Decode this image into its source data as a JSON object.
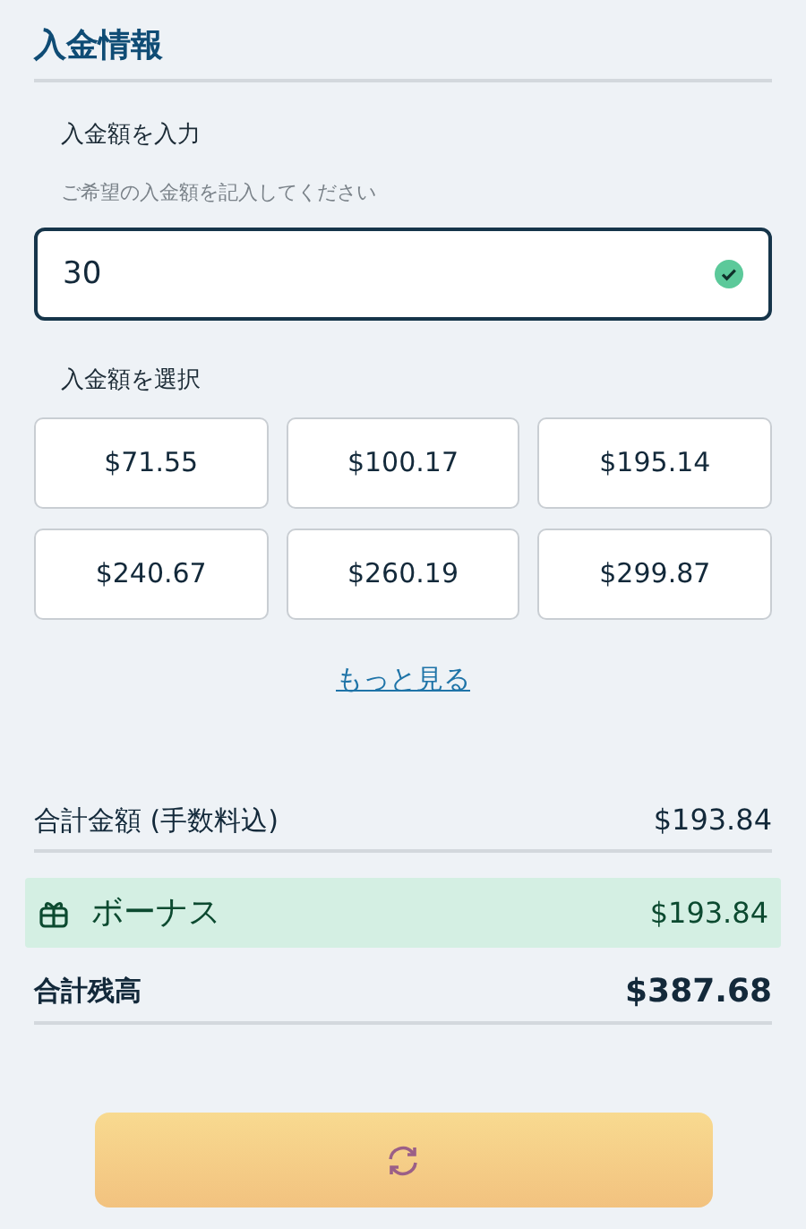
{
  "section_title": "入金情報",
  "amount_input": {
    "label": "入金額を入力",
    "hint": "ご希望の入金額を記入してください",
    "value": "30",
    "valid": true
  },
  "amount_select": {
    "label": "入金額を選択",
    "options": [
      {
        "label": "$71.55"
      },
      {
        "label": "$100.17"
      },
      {
        "label": "$195.14"
      },
      {
        "label": "$240.67"
      },
      {
        "label": "$260.19"
      },
      {
        "label": "$299.87"
      }
    ],
    "more_link": "もっと見る"
  },
  "summary": [
    {
      "kind": "total",
      "label": "合計金額 (手数料込)",
      "value": "$193.84"
    },
    {
      "kind": "bonus",
      "label": "ボーナス",
      "value": "$193.84"
    },
    {
      "kind": "balance",
      "label": "合計残高",
      "value": "$387.68"
    }
  ],
  "submit": {
    "loading": true
  }
}
